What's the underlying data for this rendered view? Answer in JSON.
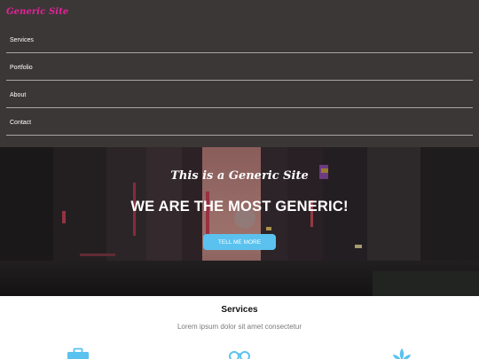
{
  "brand": {
    "name": "Generic Site",
    "color": "#e3239a"
  },
  "nav": {
    "items": [
      {
        "label": "Services"
      },
      {
        "label": "Portfolio"
      },
      {
        "label": "About"
      },
      {
        "label": "Contact"
      }
    ]
  },
  "hero": {
    "tagline": "This is a Generic Site",
    "headline": "WE ARE THE MOST GENERIC!",
    "button_label": "TELL ME MORE"
  },
  "services": {
    "title": "Services",
    "subtitle": "Lorem ipsum dolor sit amet consectetur",
    "icons": [
      "briefcase-icon",
      "glasses-icon",
      "lotus-icon"
    ]
  },
  "colors": {
    "nav_background": "#3b3736",
    "accent": "#5bc2ef",
    "brand": "#e3239a"
  }
}
